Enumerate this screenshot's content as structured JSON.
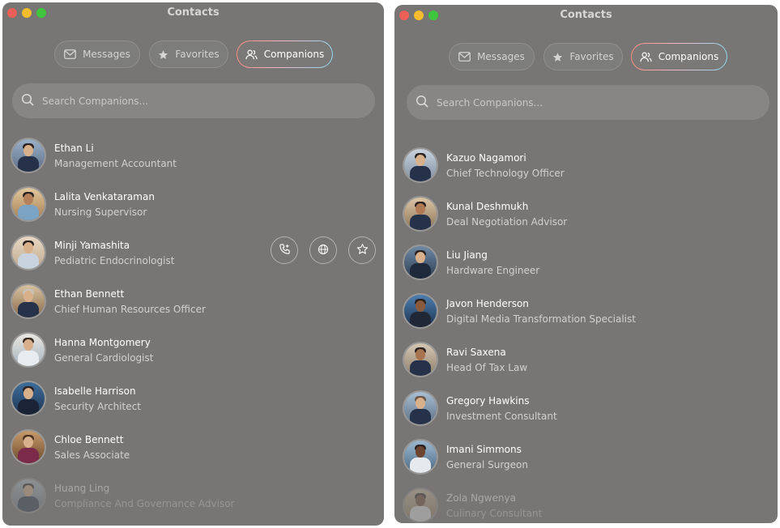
{
  "left": {
    "title": "Contacts",
    "tabs": [
      {
        "label": "Messages"
      },
      {
        "label": "Favorites"
      },
      {
        "label": "Companions",
        "active": true
      }
    ],
    "search": {
      "placeholder": "Search Companions..."
    },
    "contacts": [
      {
        "name": "Ethan Li",
        "role": "Management Accountant"
      },
      {
        "name": "Lalita Venkataraman",
        "role": "Nursing Supervisor"
      },
      {
        "name": "Minji Yamashita",
        "role": "Pediatric Endocrinologist",
        "hovered": true
      },
      {
        "name": "Ethan Bennett",
        "role": "Chief Human Resources Officer"
      },
      {
        "name": "Hanna Montgomery",
        "role": "General Cardiologist"
      },
      {
        "name": "Isabelle Harrison",
        "role": "Security Architect"
      },
      {
        "name": "Chloe Bennett",
        "role": "Sales Associate"
      },
      {
        "name": "Huang Ling",
        "role": "Compliance And Governance Advisor",
        "faded": true
      }
    ]
  },
  "right": {
    "title": "Contacts",
    "tabs": [
      {
        "label": "Messages"
      },
      {
        "label": "Favorites"
      },
      {
        "label": "Companions",
        "active": true
      }
    ],
    "search": {
      "placeholder": "Search Companions..."
    },
    "contacts": [
      {
        "name": "Kazuo Nagamori",
        "role": "Chief Technology Officer"
      },
      {
        "name": "Kunal Deshmukh",
        "role": "Deal Negotiation Advisor"
      },
      {
        "name": "Liu Jiang",
        "role": "Hardware Engineer"
      },
      {
        "name": "Javon Henderson",
        "role": "Digital Media Transformation Specialist"
      },
      {
        "name": "Ravi Saxena",
        "role": "Head Of Tax Law"
      },
      {
        "name": "Gregory Hawkins",
        "role": "Investment Consultant"
      },
      {
        "name": "Imani Simmons",
        "role": "General Surgeon"
      },
      {
        "name": "Zola Ngwenya",
        "role": "Culinary Consultant",
        "faded": true
      }
    ]
  },
  "icons": {
    "call": "phone-plus-icon",
    "web": "globe-icon",
    "favorite": "star-outline-icon"
  },
  "colors": {
    "window_bg": "#777674",
    "active_tab_gradient": [
      "#ff8a7a",
      "#f4b7c6",
      "#8bd8ef"
    ]
  }
}
